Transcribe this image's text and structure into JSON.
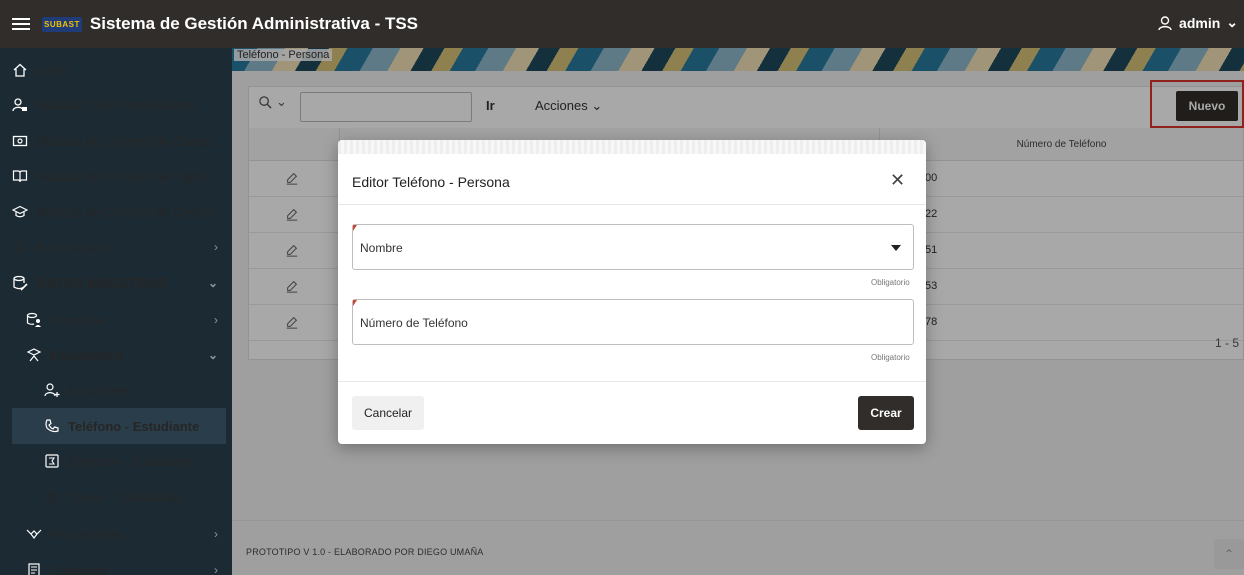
{
  "header": {
    "title": "Sistema de Gestión Administrativa - TSS",
    "user": "admin",
    "logo_text": "SUBAST"
  },
  "sidebar": {
    "items": [
      {
        "label": "Inicio",
        "icon": "home-icon"
      },
      {
        "label": "Módulo CxP Proveedores",
        "icon": "user-lock-icon"
      },
      {
        "label": "Módulo de Control de Gasto...",
        "icon": "wallet-icon"
      },
      {
        "label": "Módulo de Control de Ingre...",
        "icon": "book-open-icon"
      },
      {
        "label": "Módulo de Control de Cobros",
        "icon": "graduation-cap-icon"
      },
      {
        "label": "Facturación",
        "icon": "dollar-icon"
      },
      {
        "label": "DATOS MAESTROS",
        "icon": "database-edit-icon"
      },
      {
        "label": "Personas",
        "icon": "database-user-icon"
      },
      {
        "label": "Estudiantes",
        "icon": "student-icon"
      },
      {
        "label": "Estudiante",
        "icon": "user-add-icon"
      },
      {
        "label": "Teléfono - Estudiante",
        "icon": "phone-icon"
      },
      {
        "label": "Dirección - Estudiante",
        "icon": "address-icon"
      },
      {
        "label": "Correo - Estudiante",
        "icon": "at-icon"
      },
      {
        "label": "Proveedores",
        "icon": "handshake-icon"
      },
      {
        "label": "Catálogos",
        "icon": "catalog-icon"
      }
    ]
  },
  "breadcrumb": "Teléfono - Persona",
  "toolbar": {
    "go_label": "Ir",
    "actions_label": "Acciones",
    "new_label": "Nuevo"
  },
  "table": {
    "column_phone": "Número de Teléfono",
    "rows": [
      {
        "phone": "00"
      },
      {
        "phone": "22"
      },
      {
        "phone": "51"
      },
      {
        "phone": "53"
      },
      {
        "phone": "78"
      }
    ],
    "pagination": "1 - 5"
  },
  "footer": {
    "text": "PROTOTIPO V 1.0 - ELABORADO POR DIEGO UMAÑA"
  },
  "modal": {
    "title": "Editor Teléfono - Persona",
    "field_nombre": "Nombre",
    "field_telefono": "Número de Teléfono",
    "required_text": "Obligatorio",
    "cancel_label": "Cancelar",
    "create_label": "Crear"
  },
  "colors": {
    "header_bg": "#312d2a",
    "sidebar_bg": "#1b2a33",
    "required_marker": "#c74634",
    "highlight_border": "#d9342b"
  }
}
